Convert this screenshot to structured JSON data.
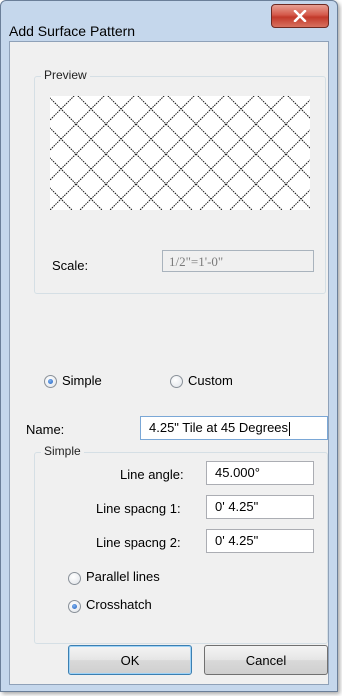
{
  "window": {
    "title": "Add Surface Pattern",
    "close_glyph": "X"
  },
  "preview_group": {
    "label": "Preview",
    "scale_label": "Scale:",
    "scale_value": "1/2\"=1'-0\""
  },
  "mode": {
    "simple_label": "Simple",
    "custom_label": "Custom",
    "selected": "Simple"
  },
  "name": {
    "label": "Name:",
    "value": "4.25\" Tile at 45 Degrees"
  },
  "simple_group": {
    "label": "Simple",
    "line_angle_label": "Line angle:",
    "line_angle_value": "45.000°",
    "line_spacing_1_label": "Line spacng 1:",
    "line_spacing_1_value": "0'  4.25\"",
    "line_spacing_2_label": "Line spacng 2:",
    "line_spacing_2_value": "0'  4.25\"",
    "parallel_label": "Parallel lines",
    "crosshatch_label": "Crosshatch",
    "selected": "Crosshatch"
  },
  "buttons": {
    "ok": "OK",
    "cancel": "Cancel"
  },
  "colors": {
    "title_bar": "#c5d7ec",
    "close_button": "#c9463a",
    "client": "#f0f0f0",
    "default_button_border": "#3c7fb1"
  }
}
